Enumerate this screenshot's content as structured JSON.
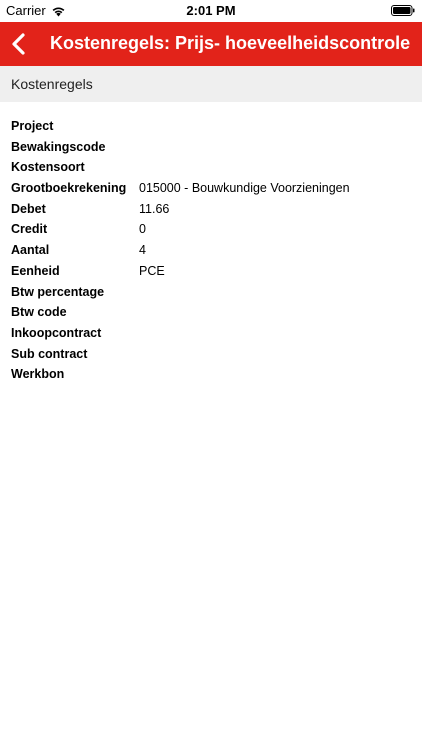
{
  "status_bar": {
    "carrier": "Carrier",
    "time": "2:01 PM"
  },
  "nav_bar": {
    "title": "Kostenregels: Prijs- hoeveelheidscontrole",
    "color": "#e2231a"
  },
  "section": {
    "title": "Kostenregels"
  },
  "details": [
    {
      "label": "Project",
      "value": ""
    },
    {
      "label": "Bewakingscode",
      "value": ""
    },
    {
      "label": "Kostensoort",
      "value": ""
    },
    {
      "label": "Grootboekrekening",
      "value": "015000 - Bouwkundige Voorzieningen"
    },
    {
      "label": "Debet",
      "value": "11.66"
    },
    {
      "label": "Credit",
      "value": "0"
    },
    {
      "label": "Aantal",
      "value": "4"
    },
    {
      "label": "Eenheid",
      "value": "PCE"
    },
    {
      "label": "Btw percentage",
      "value": ""
    },
    {
      "label": "Btw code",
      "value": ""
    },
    {
      "label": "Inkoopcontract",
      "value": ""
    },
    {
      "label": "Sub contract",
      "value": ""
    },
    {
      "label": "Werkbon",
      "value": ""
    }
  ]
}
